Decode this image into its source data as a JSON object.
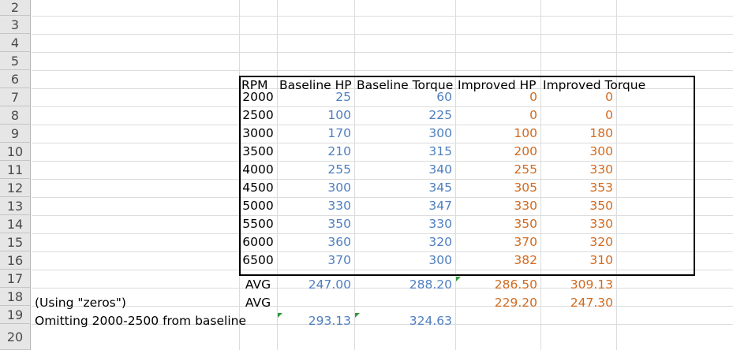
{
  "row_numbers": [
    "2",
    "3",
    "4",
    "5",
    "6",
    "7",
    "8",
    "9",
    "10",
    "11",
    "12",
    "13",
    "14",
    "15",
    "16",
    "17",
    "18",
    "19",
    "20"
  ],
  "table": {
    "headers": {
      "rpm": "RPM",
      "baseline_hp": "Baseline HP",
      "baseline_torque": "Baseline Torque",
      "improved_hp": "Improved HP",
      "improved_torque": "Improved Torque"
    },
    "rows": [
      {
        "rpm": "2000",
        "bhp": "25",
        "btq": "60",
        "ihp": "0",
        "itq": "0"
      },
      {
        "rpm": "2500",
        "bhp": "100",
        "btq": "225",
        "ihp": "0",
        "itq": "0"
      },
      {
        "rpm": "3000",
        "bhp": "170",
        "btq": "300",
        "ihp": "100",
        "itq": "180"
      },
      {
        "rpm": "3500",
        "bhp": "210",
        "btq": "315",
        "ihp": "200",
        "itq": "300"
      },
      {
        "rpm": "4000",
        "bhp": "255",
        "btq": "340",
        "ihp": "255",
        "itq": "330"
      },
      {
        "rpm": "4500",
        "bhp": "300",
        "btq": "345",
        "ihp": "305",
        "itq": "353"
      },
      {
        "rpm": "5000",
        "bhp": "330",
        "btq": "347",
        "ihp": "330",
        "itq": "350"
      },
      {
        "rpm": "5500",
        "bhp": "350",
        "btq": "330",
        "ihp": "350",
        "itq": "330"
      },
      {
        "rpm": "6000",
        "bhp": "360",
        "btq": "320",
        "ihp": "370",
        "itq": "320"
      },
      {
        "rpm": "6500",
        "bhp": "370",
        "btq": "300",
        "ihp": "382",
        "itq": "310"
      }
    ]
  },
  "avg_row": {
    "label": "AVG",
    "bhp": "247.00",
    "btq": "288.20",
    "ihp": "286.50",
    "itq": "309.13"
  },
  "zeros_row": {
    "note": "(Using \"zeros\")",
    "label": "AVG",
    "ihp": "229.20",
    "itq": "247.30"
  },
  "omit_row": {
    "note": "Omitting 2000-2500 from baseline",
    "bhp": "293.13",
    "btq": "324.63"
  },
  "colors": {
    "baseline": "#4f7fbf",
    "improved": "#d26a1f",
    "row_header_bg": "#e6e6e6",
    "grid": "#dcdcdc"
  }
}
